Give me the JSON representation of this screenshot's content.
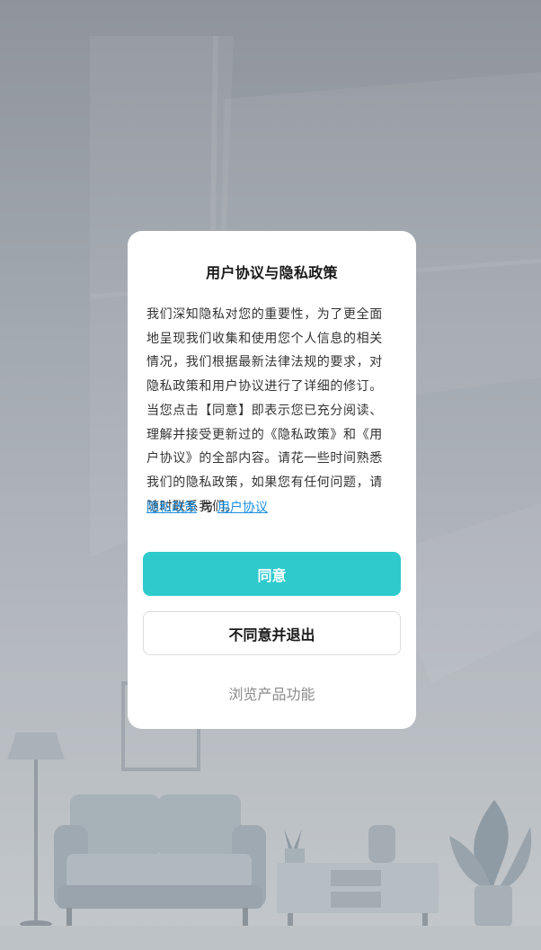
{
  "dialog": {
    "title": "用户协议与隐私政策",
    "body": "我们深知隐私对您的重要性，为了更全面地呈现我们收集和使用您个人信息的相关情况，我们根据最新法律法规的要求，对隐私政策和用户协议进行了详细的修订。当您点击【同意】即表示您已充分阅读、理解并接受更新过的《隐私政策》和《用户协议》的全部内容。请花一些时间熟悉我们的隐私政策，如果您有任何问题，请随时联系我们。",
    "link_privacy": "隐私政策",
    "link_separator": "与",
    "link_agreement": "用户协议",
    "agree_label": "同意",
    "disagree_label": "不同意并退出",
    "browse_label": "浏览产品功能"
  },
  "colors": {
    "accent": "#2ecacc",
    "link": "#1d8fe0",
    "overlay": "#9aa0a8"
  }
}
